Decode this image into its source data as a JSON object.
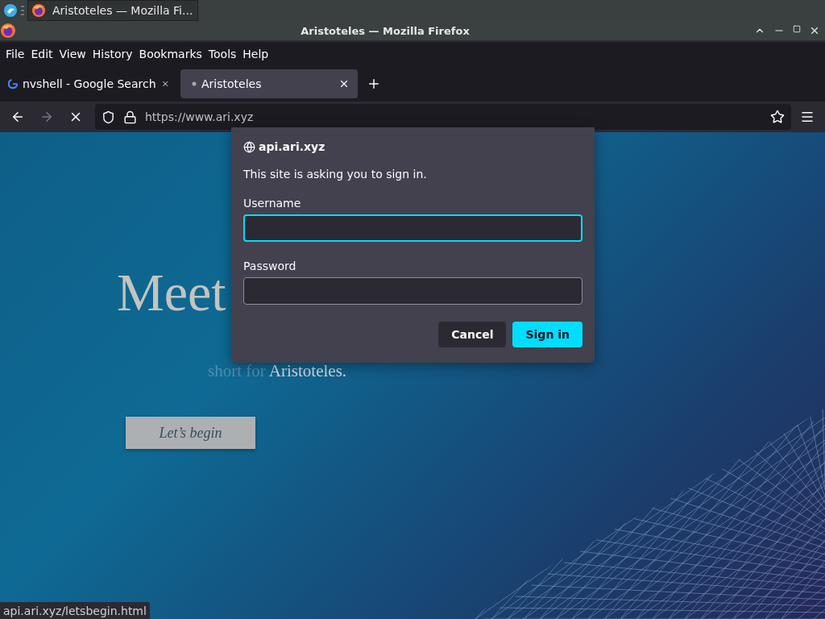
{
  "taskbar": {
    "task": "Aristoteles — Mozilla Fi..."
  },
  "window": {
    "title": "Aristoteles — Mozilla Firefox"
  },
  "menu": [
    "File",
    "Edit",
    "View",
    "History",
    "Bookmarks",
    "Tools",
    "Help"
  ],
  "tabs": [
    {
      "label": "nvshell - Google Search",
      "selected": false,
      "kind": "google"
    },
    {
      "label": "Aristoteles",
      "selected": true,
      "kind": "loading"
    }
  ],
  "address": {
    "value": "https://www.ari.xyz"
  },
  "page": {
    "heading": "Meet",
    "subtitle_lead": "short for",
    "subtitle_name": "Aristoteles.",
    "button": "Let’s begin"
  },
  "dialog": {
    "host": "api.ari.xyz",
    "message": "This site is asking you to sign in.",
    "username_label": "Username",
    "password_label": "Password",
    "cancel": "Cancel",
    "sign_in": "Sign in"
  },
  "status_bar": "api.ari.xyz/letsbegin.html"
}
